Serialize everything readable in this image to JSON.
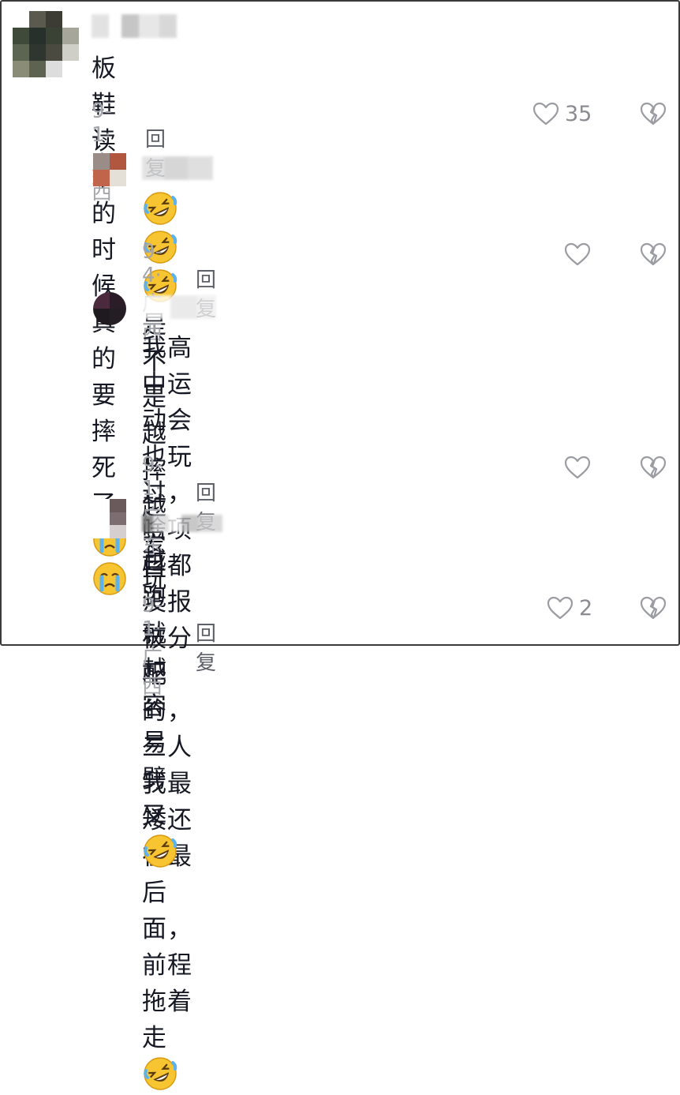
{
  "comments": [
    {
      "text": "板鞋  读书的时候真的要摔死了",
      "emoji": [
        "crying-face",
        "crying-face"
      ],
      "meta": "9-1· 广西",
      "reply": "回复",
      "likes": "35"
    },
    {
      "emoji_prefix": [
        "rolling-laughing-face",
        "rolling-laughing-face",
        "rolling-laughing-face"
      ],
      "text": "是不是越摔越爱玩",
      "meta": "9-4· 广西",
      "reply": "回复",
      "likes": ""
    },
    {
      "text_line1": "我高中运动会也玩过，啥项目都没报被分",
      "text_line2": "配的，三人我最矮还在最后面，前程拖着",
      "text_line3": "走",
      "emoji": [
        "rolling-laughing-face"
      ],
      "meta": "9-1· 广东",
      "reply": "回复",
      "likes": ""
    },
    {
      "text": "越跑就越容易劈叉",
      "emoji": [
        "rolling-laughing-face"
      ],
      "meta": "9-1· 广西",
      "reply": "回复",
      "likes": "2"
    }
  ],
  "colors": {
    "text": "#161823",
    "meta": "#a3a5ab",
    "reply": "#5e6068",
    "icon": "#8a8c92",
    "emoji_face": "#f7c531"
  },
  "icons": [
    "heart-outline-icon",
    "broken-heart-icon"
  ]
}
